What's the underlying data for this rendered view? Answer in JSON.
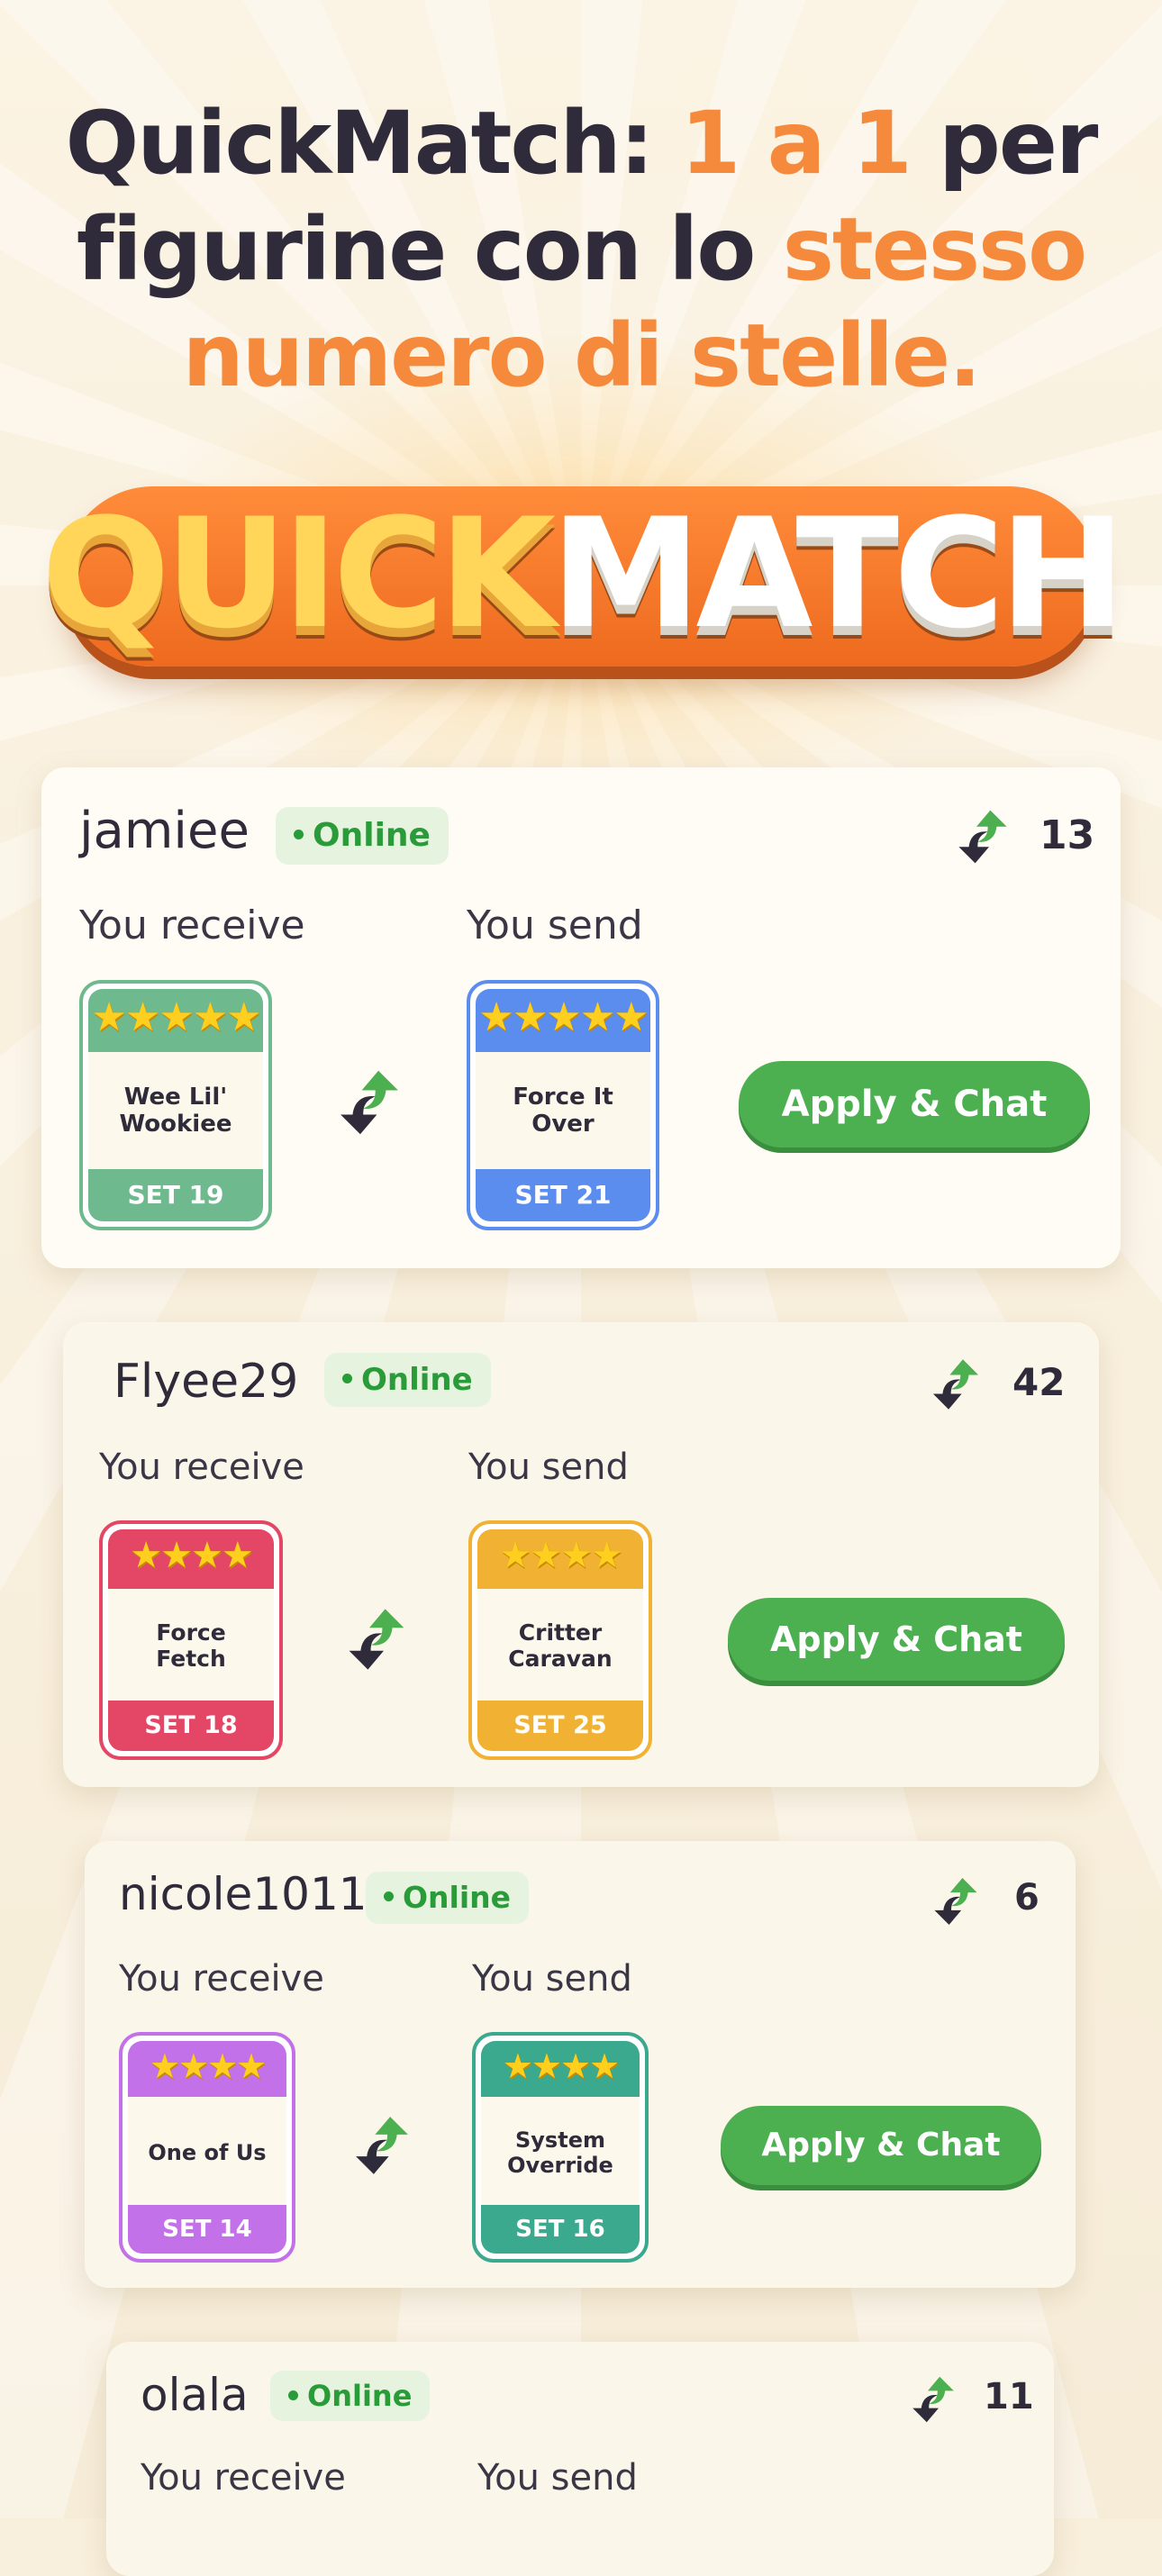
{
  "headline": {
    "line1_a": "QuickMatch: ",
    "line1_b": "1 a 1",
    "line1_c": " per",
    "line2_a": "figurine con lo ",
    "line2_b": "stesso",
    "line3": "numero di stelle."
  },
  "logo": {
    "part1": "QUICK",
    "part2": "MATCH"
  },
  "labels": {
    "receive": "You receive",
    "send": "You send",
    "apply": "Apply & Chat"
  },
  "colors": {
    "online": "#2a9b39",
    "button": "#4caf50",
    "accent": "#f58a3c"
  },
  "matches": [
    {
      "user": "jamiee",
      "status": "Online",
      "count": "13",
      "receive": {
        "name": "Wee Lil' Wookiee",
        "set": "SET 19",
        "stars": "★★★★★",
        "color": "#6fb98f"
      },
      "send": {
        "name": "Force It Over",
        "set": "SET 21",
        "stars": "★★★★★",
        "color": "#5b8def"
      }
    },
    {
      "user": "Flyee29",
      "status": "Online",
      "count": "42",
      "receive": {
        "name": "Force Fetch",
        "set": "SET 18",
        "stars": "★★★★",
        "color": "#e44766"
      },
      "send": {
        "name": "Critter Caravan",
        "set": "SET 25",
        "stars": "★★★★",
        "color": "#f1b233"
      }
    },
    {
      "user": "nicole1011",
      "status": "Online",
      "count": "6",
      "receive": {
        "name": "One of Us",
        "set": "SET 14",
        "stars": "★★★★",
        "color": "#c271e8"
      },
      "send": {
        "name": "System Override",
        "set": "SET 16",
        "stars": "★★★★",
        "color": "#3aa98e"
      }
    },
    {
      "user": "olala",
      "status": "Online",
      "count": "11"
    }
  ]
}
